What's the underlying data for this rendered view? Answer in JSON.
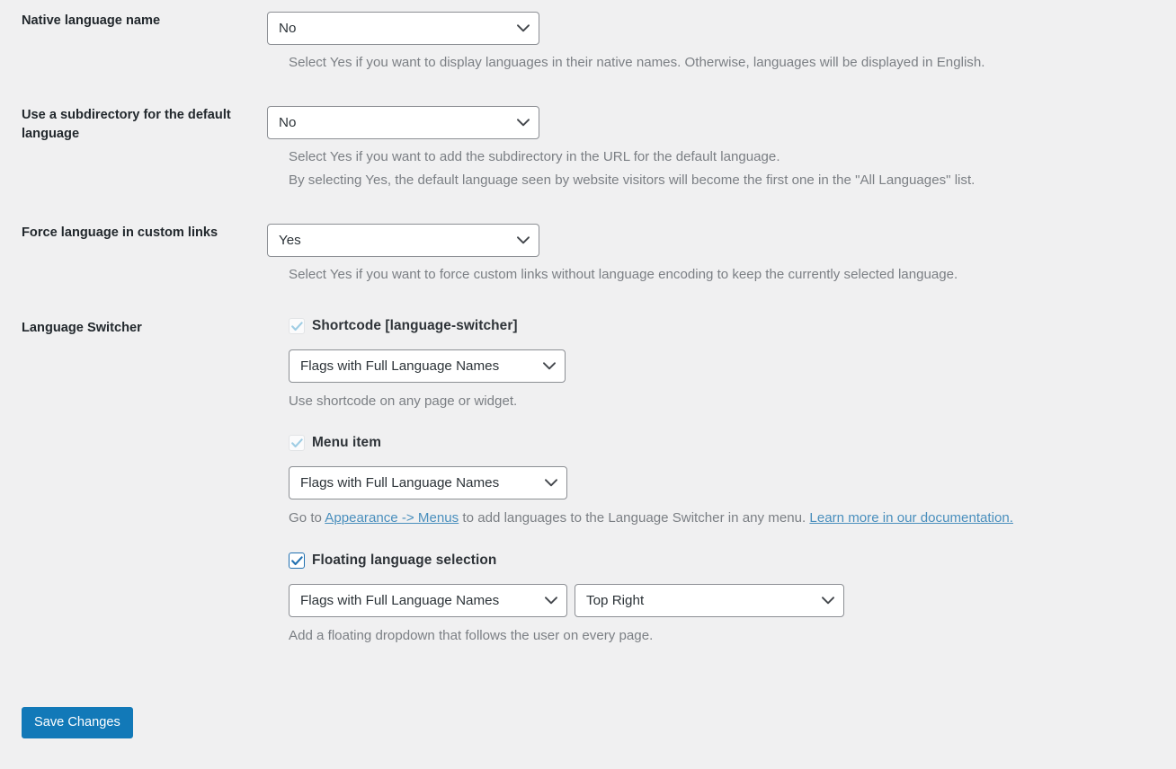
{
  "form": {
    "rows": [
      {
        "key": "native_language_name",
        "label": "Native language name",
        "value": "No",
        "description": [
          "Select Yes if you want to display languages in their native names. Otherwise, languages will be displayed in English."
        ]
      },
      {
        "key": "use_subdirectory_default_language",
        "label": "Use a subdirectory for the default language",
        "value": "No",
        "description": [
          "Select Yes if you want to add the subdirectory in the URL for the default language.",
          "By selecting Yes, the default language seen by website visitors will become the first one in the \"All Languages\" list."
        ]
      },
      {
        "key": "force_language_custom_links",
        "label": "Force language in custom links",
        "value": "Yes",
        "description": [
          "Select Yes if you want to force custom links without language encoding to keep the currently selected language."
        ]
      }
    ],
    "language_switcher": {
      "label": "Language Switcher",
      "shortcode": {
        "checkbox_label": "Shortcode [language-switcher]",
        "checked": true,
        "select_value": "Flags with Full Language Names",
        "description": "Use shortcode on any page or widget."
      },
      "menu_item": {
        "checkbox_label": "Menu item",
        "checked": true,
        "select_value": "Flags with Full Language Names",
        "description_prefix": "Go to ",
        "description_link": "Appearance -> Menus",
        "description_middle": " to add languages to the Language Switcher in any menu. ",
        "description_link2": "Learn more in our documentation."
      },
      "floating": {
        "checkbox_label": "Floating language selection",
        "checked": true,
        "select_value": "Flags with Full Language Names",
        "position_value": "Top Right",
        "description": "Add a floating dropdown that follows the user on every page."
      }
    },
    "save_button": "Save Changes"
  },
  "icons": {
    "chevron_down": "chevron-down-icon",
    "check": "check-icon"
  },
  "colors": {
    "page_background": "#f0f0f1",
    "label_text": "#22282d",
    "description_text": "#7b7f84",
    "link": "#4a8fbd",
    "primary_button": "#1279b8",
    "checkbox_accent": "#2271b1",
    "select_border": "#8c8f94"
  }
}
